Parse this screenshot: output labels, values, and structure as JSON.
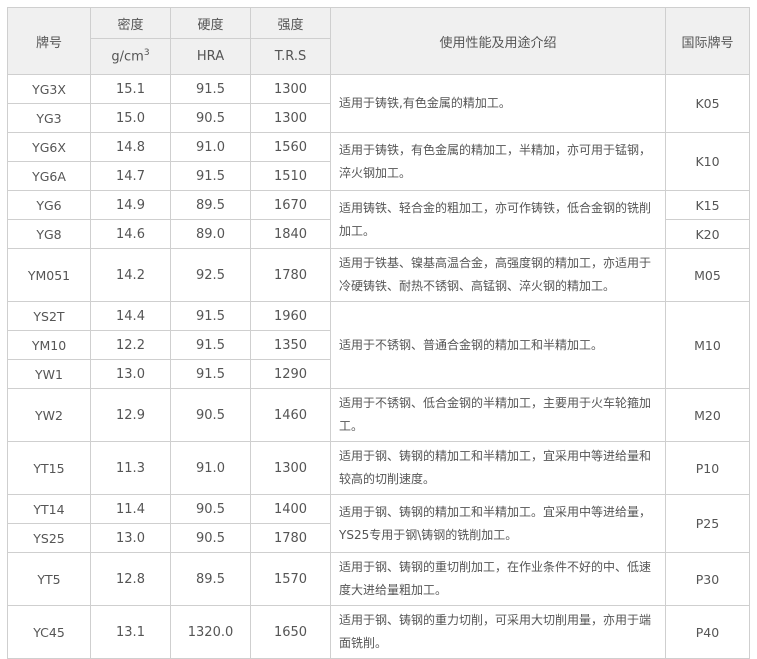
{
  "headers": {
    "grade": "牌号",
    "density": "密度",
    "density_unit_base": "g/cm",
    "density_unit_sup": "3",
    "hardness": "硬度",
    "hardness_unit": "HRA",
    "strength": "强度",
    "strength_unit": "T.R.S",
    "usage": "使用性能及用途介绍",
    "intl_grade": "国际牌号"
  },
  "rows": [
    {
      "grade": "YG3X",
      "density": "15.1",
      "hardness": "91.5",
      "strength": "1300"
    },
    {
      "grade": "YG3",
      "density": "15.0",
      "hardness": "90.5",
      "strength": "1300"
    },
    {
      "grade": "YG6X",
      "density": "14.8",
      "hardness": "91.0",
      "strength": "1560"
    },
    {
      "grade": "YG6A",
      "density": "14.7",
      "hardness": "91.5",
      "strength": "1510"
    },
    {
      "grade": "YG6",
      "density": "14.9",
      "hardness": "89.5",
      "strength": "1670"
    },
    {
      "grade": "YG8",
      "density": "14.6",
      "hardness": "89.0",
      "strength": "1840"
    },
    {
      "grade": "YM051",
      "density": "14.2",
      "hardness": "92.5",
      "strength": "1780"
    },
    {
      "grade": "YS2T",
      "density": "14.4",
      "hardness": "91.5",
      "strength": "1960"
    },
    {
      "grade": "YM10",
      "density": "12.2",
      "hardness": "91.5",
      "strength": "1350"
    },
    {
      "grade": "YW1",
      "density": "13.0",
      "hardness": "91.5",
      "strength": "1290"
    },
    {
      "grade": "YW2",
      "density": "12.9",
      "hardness": "90.5",
      "strength": "1460"
    },
    {
      "grade": "YT15",
      "density": "11.3",
      "hardness": "91.0",
      "strength": "1300"
    },
    {
      "grade": "YT14",
      "density": "11.4",
      "hardness": "90.5",
      "strength": "1400"
    },
    {
      "grade": "YS25",
      "density": "13.0",
      "hardness": "90.5",
      "strength": "1780"
    },
    {
      "grade": "YT5",
      "density": "12.8",
      "hardness": "89.5",
      "strength": "1570"
    },
    {
      "grade": "YC45",
      "density": "13.1",
      "hardness": "1320.0",
      "strength": "1650"
    }
  ],
  "usages": [
    "适用于铸铁,有色金属的精加工。",
    "适用于铸铁，有色金属的精加工，半精加，亦可用于锰钢，淬火钢加工。",
    "适用铸铁、轻合金的粗加工，亦可作铸铁，低合金钢的铣削加工。",
    "适用于铁基、镍基高温合金，高强度钢的精加工，亦适用于冷硬铸铁、耐热不锈钢、高锰钢、淬火钢的精加工。",
    "适用于不锈钢、普通合金钢的精加工和半精加工。",
    "适用于不锈钢、低合金钢的半精加工，主要用于火车轮箍加工。",
    "适用于钢、铸钢的精加工和半精加工，宜采用中等进给量和较高的切削速度。",
    "适用于钢、铸钢的精加工和半精加工。宜采用中等进给量，YS25专用于钢\\铸钢的铣削加工。",
    "适用于钢、铸钢的重切削加工，在作业条件不好的中、低速度大进给量粗加工。",
    "适用于钢、铸钢的重力切削，可采用大切削用量，亦用于端面铣削。"
  ],
  "intl_grades": [
    "K05",
    "K10",
    "K15",
    "K20",
    "M05",
    "M10",
    "M20",
    "P10",
    "P25",
    "P30",
    "P40"
  ]
}
